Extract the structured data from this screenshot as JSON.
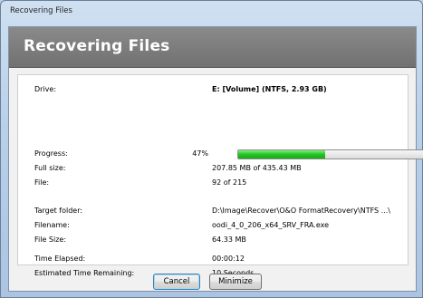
{
  "window": {
    "title": "Recovering Files"
  },
  "banner": {
    "title": "Recovering Files"
  },
  "details": {
    "drive_label": "Drive:",
    "drive_value": "E: [Volume] (NTFS, 2.93 GB)",
    "progress_label": "Progress:",
    "progress_percent_text": "47%",
    "progress_value": 0.47,
    "full_size_label": "Full size:",
    "full_size_value": "207.85 MB of 435.43 MB",
    "file_label": "File:",
    "file_value": "92 of 215",
    "target_folder_label": "Target folder:",
    "target_folder_value": "D:\\Image\\Recover\\O&O FormatRecovery\\NTFS ...\\",
    "filename_label": "Filename:",
    "filename_value": "oodi_4_0_206_x64_SRV_FRA.exe",
    "file_size_label": "File Size:",
    "file_size_value": "64.33 MB",
    "time_elapsed_label": "Time Elapsed:",
    "time_elapsed_value": "00:00:12",
    "time_remaining_label": "Estimated Time Remaining:",
    "time_remaining_value": "10 Seconds"
  },
  "buttons": {
    "cancel": "Cancel",
    "minimize": "Minimize"
  },
  "colors": {
    "progress_fill": "#22c322",
    "banner": "#7d7d7d"
  }
}
